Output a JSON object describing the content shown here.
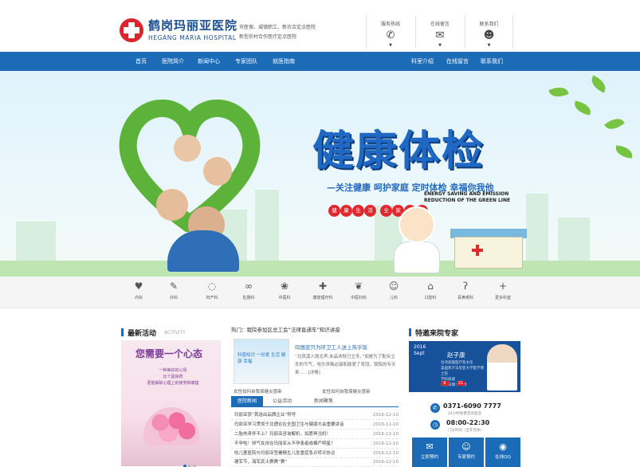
{
  "header": {
    "logo_cn": "鹤岗玛丽亚医院",
    "logo_en": "HEGANG MARIA HOSPITAL",
    "slogans": [
      "市医保、城镇职工、新农合定点医院",
      "新型农村合作医疗定点医院"
    ],
    "boxes": [
      {
        "label": "服务热线",
        "icon": "phone-icon"
      },
      {
        "label": "在线留言",
        "icon": "chat-icon"
      },
      {
        "label": "联系我们",
        "icon": "people-icon"
      }
    ]
  },
  "nav": {
    "left": [
      "首页",
      "医院简介",
      "新闻中心",
      "专家团队",
      "就医指南"
    ],
    "right": [
      "科室介绍",
      "在线留言",
      "联系我们"
    ]
  },
  "banner": {
    "headline": "健康体检",
    "subline": "—关注健康 呵护家庭 定时体检 幸福你我他",
    "energy": [
      "ENERGY SAVING AND EMISSION",
      "REDUCTION OF THE GREEN LINE"
    ],
    "pills": [
      "健",
      "康",
      "生",
      "活",
      "全",
      "家",
      "幸",
      "福"
    ]
  },
  "departments": [
    {
      "label": "内科",
      "icon": "stomach-icon",
      "glyph": "♥"
    },
    {
      "label": "外科",
      "icon": "scalpel-icon",
      "glyph": "✎"
    },
    {
      "label": "妇产科",
      "icon": "baby-icon",
      "glyph": "◌"
    },
    {
      "label": "肛肠科",
      "icon": "intestine-icon",
      "glyph": "∞"
    },
    {
      "label": "中医科",
      "icon": "herb-icon",
      "glyph": "❀"
    },
    {
      "label": "康复理疗科",
      "icon": "firstaid-icon",
      "glyph": "✚"
    },
    {
      "label": "中医妇科",
      "icon": "leaf-icon",
      "glyph": "❦"
    },
    {
      "label": "儿科",
      "icon": "child-icon",
      "glyph": "☺"
    },
    {
      "label": "口腔科",
      "icon": "tooth-icon",
      "glyph": "⌂"
    },
    {
      "label": "耳鼻喉科",
      "icon": "ear-icon",
      "glyph": "ʔ"
    },
    {
      "label": "更多科室",
      "icon": "plus-icon",
      "glyph": "+"
    }
  ],
  "activity": {
    "title": "最新活动",
    "en": "ACTIVITY",
    "poster_title": "您需要一个心态",
    "poster_lines": [
      "一种美好的心情",
      "比十副良药",
      "更能解除心理上的疲劳和痛楚"
    ]
  },
  "news": {
    "hot": "热门：我院参加区总工会“法律直通车”知识讲座",
    "thumb_text": "科普知识 一份爱 生活 健康 幸福",
    "feature_title": "玛丽亚只为环卫工人送上热乎饭",
    "feature_text": "“北风凛入饱无声,未品浓秋已立冬。”如是为了配合立冬的节气，哈尔滨俄必康和慈爱了育冠，我院的专天来……[详情]",
    "captions": [
      "女性如何自我保健炎感染",
      "女性如何自我保健炎感染"
    ],
    "tabs": [
      "医院新闻",
      "公益活动",
      "新闻聚焦"
    ],
    "items": [
      {
        "t": "玛丽亚获“首选出品牌企业”称号",
        "d": "2016-12-10"
      },
      {
        "t": "玛丽亚学习贯彻于北理论在全国卫生与健康大会重要讲话",
        "d": "2016-12-10"
      },
      {
        "t": "二胎热来怀不上？玛丽亚咨询解析，如愿再当妈！",
        "d": "2016-12-10"
      },
      {
        "t": "不孕啦！卵气女孩在玛丽亚从不孕患者成模产明星！",
        "d": "2016-12-10"
      },
      {
        "t": "哈儿童医院与玛丽亚签署精生儿急重症急诊转诊协议",
        "d": "2016-12-10"
      },
      {
        "t": "建军节，海军武士赛赛“赛”",
        "d": "2016-12-10"
      }
    ]
  },
  "experts": {
    "title": "特邀来院专家",
    "year": "2016",
    "month": "Sept",
    "name": "赵子康",
    "desc": [
      "台湾高雄医疗系主任",
      "美国宾夕法尼亚大学医学博士后",
      "学科权威",
      "来院日期：12月"
    ],
    "pages": [
      "6",
      "21"
    ],
    "phone": "0371-6090 7777",
    "phone_sub": "24小时免费咨询电话",
    "hours": "08:00-22:30",
    "hours_sub": "门诊时间（全年无休）",
    "buttons": [
      "立即预约",
      "专家预约",
      "在线QQ"
    ]
  },
  "colors": {
    "brand": "#1b6bb7",
    "accent": "#d9252b"
  }
}
